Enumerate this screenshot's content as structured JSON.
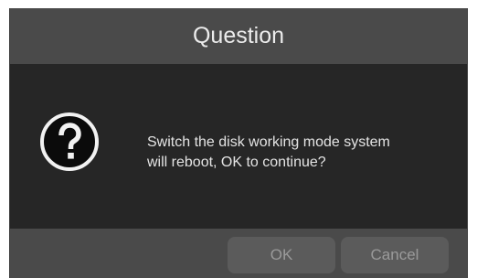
{
  "dialog": {
    "title": "Question",
    "icon": "question-icon",
    "message": [
      "Switch the disk working mode system",
      "will reboot, OK to continue?"
    ],
    "buttons": {
      "ok_label": "OK",
      "cancel_label": "Cancel"
    }
  },
  "colors": {
    "titlebar": "#4a4a4a",
    "body": "#262626",
    "button": "#5b5b5b",
    "text": "#e4e4e4"
  }
}
